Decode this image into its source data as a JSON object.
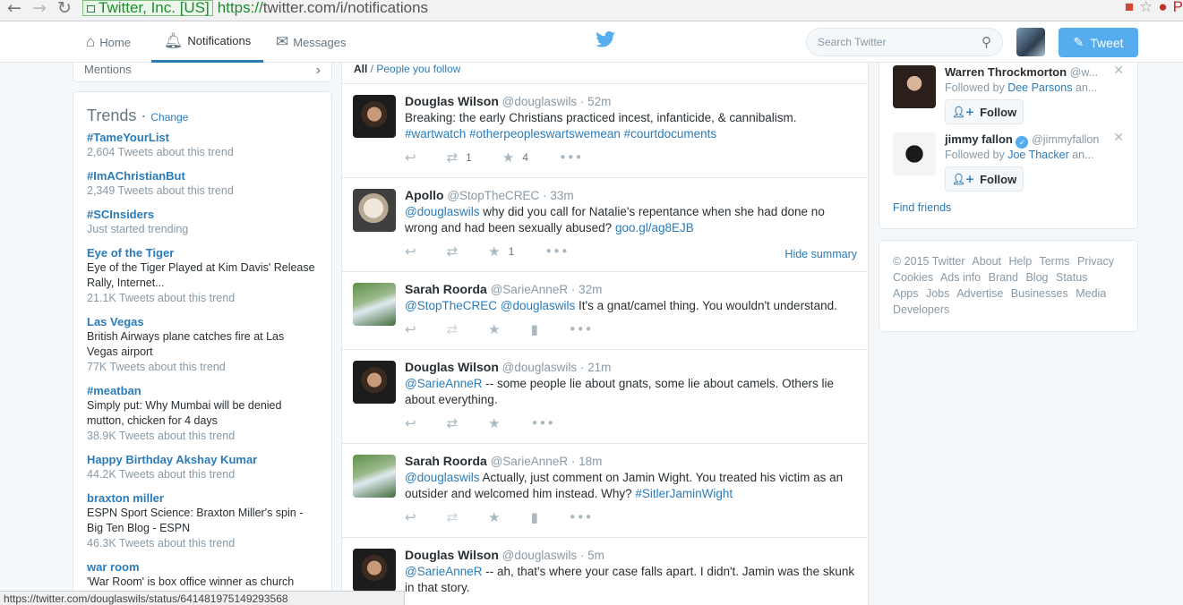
{
  "browser": {
    "security_label": "Twitter, Inc. [US]",
    "url_scheme": "https://",
    "url_rest": "twitter.com/i/notifications",
    "status_url": "https://twitter.com/douglaswils/status/641481975149293568"
  },
  "topnav": {
    "home": "Home",
    "notifications": "Notifications",
    "messages": "Messages",
    "search_placeholder": "Search Twitter",
    "tweet_button": "Tweet"
  },
  "left": {
    "mentions": "Mentions",
    "trends_title": "Trends",
    "trends_change": "Change",
    "trends": [
      {
        "name": "#TameYourList",
        "desc": "",
        "count": "2,604 Tweets about this trend"
      },
      {
        "name": "#ImAChristianBut",
        "desc": "",
        "count": "2,349 Tweets about this trend"
      },
      {
        "name": "#SCInsiders",
        "desc": "",
        "count": "Just started trending"
      },
      {
        "name": "Eye of the Tiger",
        "desc": "Eye of the Tiger Played at Kim Davis' Release Rally, Internet...",
        "count": "21.1K Tweets about this trend"
      },
      {
        "name": "Las Vegas",
        "desc": "British Airways plane catches fire at Las Vegas airport",
        "count": "77K Tweets about this trend"
      },
      {
        "name": "#meatban",
        "desc": "Simply put: Why Mumbai will be denied mutton, chicken for 4 days",
        "count": "38.9K Tweets about this trend"
      },
      {
        "name": "Happy Birthday Akshay Kumar",
        "desc": "",
        "count": "44.2K Tweets about this trend"
      },
      {
        "name": "braxton miller",
        "desc": "ESPN Sport Science: Braxton Miller's spin - Big Ten Blog - ESPN",
        "count": "46.3K Tweets about this trend"
      },
      {
        "name": "war room",
        "desc": "'War Room' is box office winner as church",
        "count": ""
      }
    ]
  },
  "stream": {
    "filter_all": "All",
    "filter_sep": " / ",
    "filter_people": "People you follow",
    "hide_summary": "Hide summary",
    "tweets": [
      {
        "name": "Douglas Wilson",
        "handle": "@douglaswils",
        "time": "52m",
        "text": "Breaking: the early Christians practiced incest, infanticide, & cannibalism.",
        "tags": "#wartwatch #otherpeopleswartswemean #courtdocuments",
        "retweets": "1",
        "likes": "4"
      },
      {
        "name": "Apollo",
        "handle": "@StopTheCREC",
        "time": "33m",
        "mention": "@douglaswils",
        "text": " why did you call for Natalie's repentance when she had done no wrong and had been sexually abused? ",
        "link": "goo.gl/ag8EJB",
        "likes": "1"
      },
      {
        "name": "Sarah Roorda",
        "handle": "@SarieAnneR",
        "time": "32m",
        "mention": "@StopTheCREC @douglaswils",
        "text": " It's a gnat/camel thing. You wouldn't understand."
      },
      {
        "name": "Douglas Wilson",
        "handle": "@douglaswils",
        "time": "21m",
        "mention": "@SarieAnneR",
        "text": " -- some people lie about gnats, some lie about camels. Others lie about everything."
      },
      {
        "name": "Sarah Roorda",
        "handle": "@SarieAnneR",
        "time": "18m",
        "mention": "@douglaswils",
        "text": " Actually, just comment on Jamin Wight. You treated his victim as an outsider and welcomed him instead. Why? ",
        "tag": "#SitlerJaminWight"
      },
      {
        "name": "Douglas Wilson",
        "handle": "@douglaswils",
        "time": "5m",
        "mention": "@SarieAnneR",
        "text": " -- ah, that's where your case falls apart. I didn't. Jamin was the skunk in that story."
      }
    ]
  },
  "right": {
    "suggestions": [
      {
        "name": "Warren Throckmorton",
        "handle": "@w...",
        "followed_prefix": "Followed by ",
        "followed_by": "Dee Parsons",
        "followed_suffix": " an...",
        "follow": "Follow"
      },
      {
        "name": "jimmy fallon",
        "handle": "@jimmyfallon",
        "followed_prefix": "Followed by ",
        "followed_by": "Joe Thacker",
        "followed_suffix": " an...",
        "follow": "Follow"
      }
    ],
    "find_friends": "Find friends",
    "footer": [
      "© 2015 Twitter",
      "About",
      "Help",
      "Terms",
      "Privacy",
      "Cookies",
      "Ads info",
      "Brand",
      "Blog",
      "Status",
      "Apps",
      "Jobs",
      "Advertise",
      "Businesses",
      "Media",
      "Developers"
    ]
  },
  "colors": {
    "link": "#2b7bb9",
    "tweet_button": "#55acee",
    "muted": "#8899a6"
  }
}
